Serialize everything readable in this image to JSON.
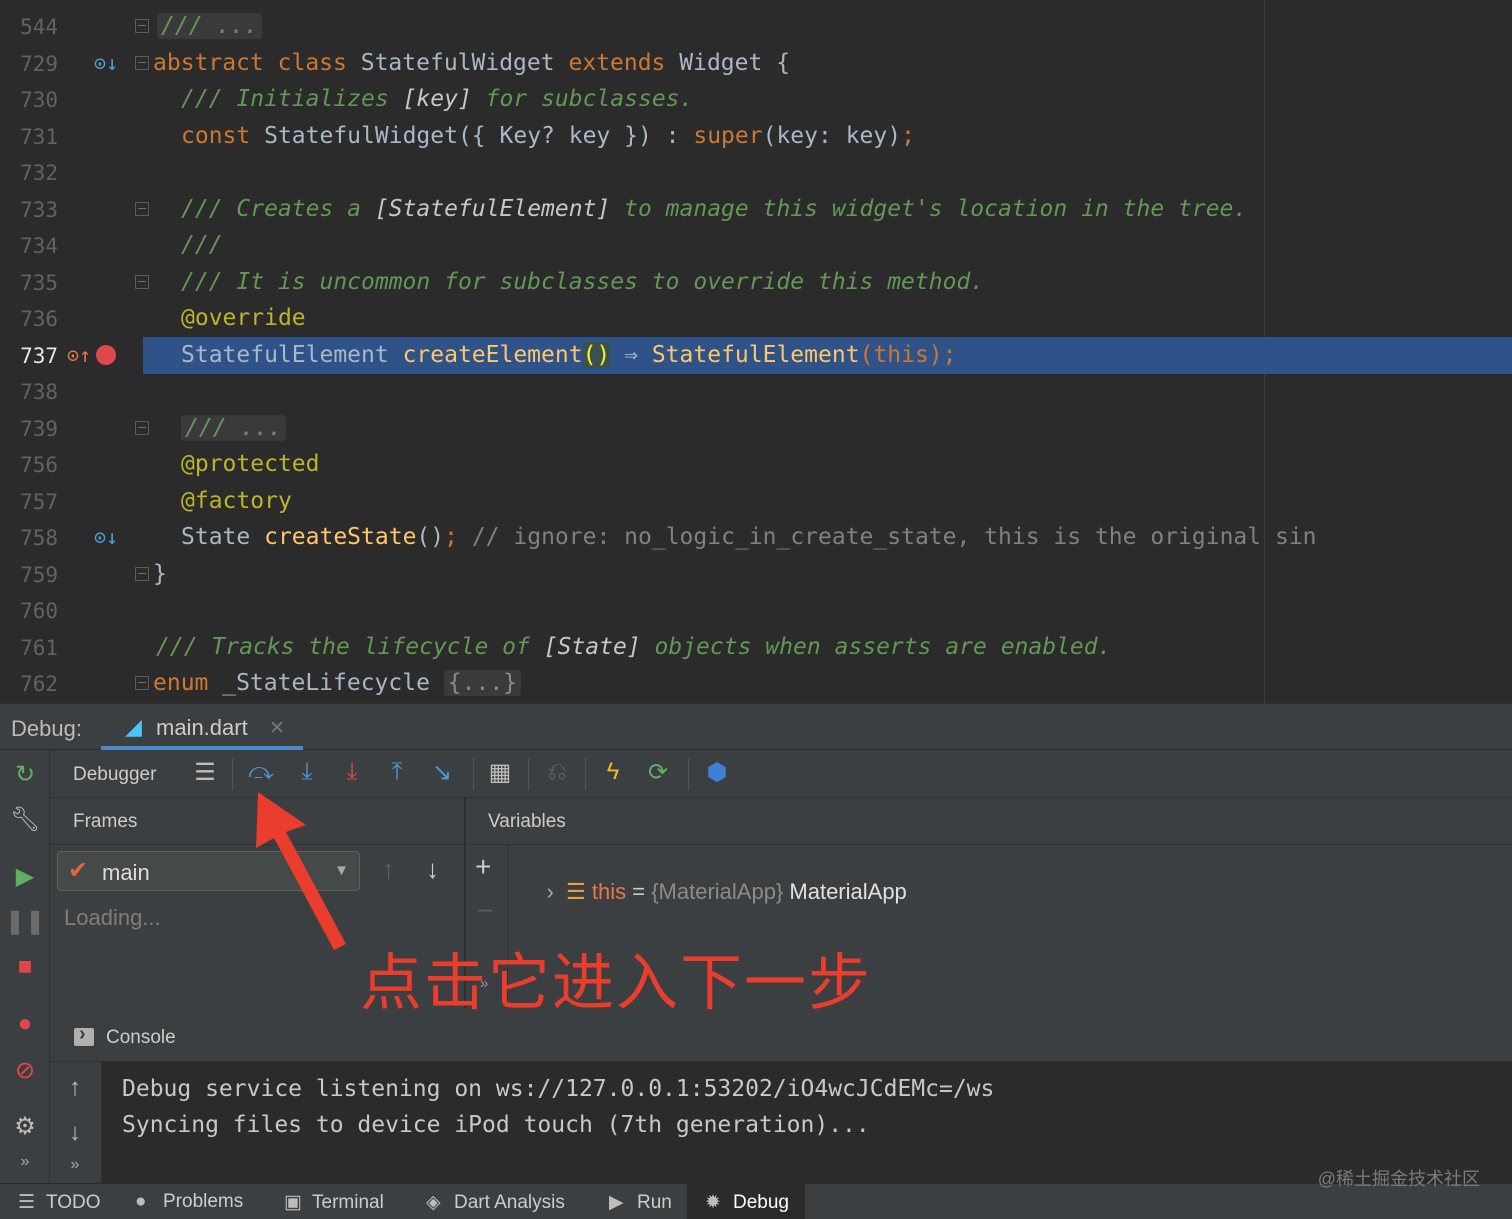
{
  "editor": {
    "lines": [
      {
        "num": "544",
        "text": "/// ..."
      },
      {
        "num": "729",
        "kw1": "abstract class",
        "name": "StatefulWidget",
        "kw2": "extends",
        "base": "Widget {"
      },
      {
        "num": "730",
        "comment_a": "/// Initializes ",
        "ref": "[key]",
        "comment_b": " for subclasses."
      },
      {
        "num": "731",
        "kw": "const",
        "body": " StatefulWidget({ Key? key }) : ",
        "sup": "super",
        "args": "(key: key)",
        "semi": ";"
      },
      {
        "num": "732"
      },
      {
        "num": "733",
        "comment_a": "/// Creates a ",
        "ref": "[StatefulElement]",
        "comment_b": " to manage this widget's location in the tree."
      },
      {
        "num": "734",
        "comment": "///"
      },
      {
        "num": "735",
        "comment": "/// It is uncommon for subclasses to override this method."
      },
      {
        "num": "736",
        "ann": "@",
        "text": "override"
      },
      {
        "num": "737",
        "type": "StatefulElement ",
        "fn": "createElement",
        "paren": "()",
        "arrow": " ⇒ ",
        "call": "StatefulElement",
        "open": "(",
        "thiskw": "this",
        "close": ")",
        "semi": ";"
      },
      {
        "num": "738"
      },
      {
        "num": "739",
        "text": "/// ..."
      },
      {
        "num": "756",
        "ann": "@",
        "text": "protected"
      },
      {
        "num": "757",
        "ann": "@",
        "text": "factory"
      },
      {
        "num": "758",
        "type": "State ",
        "fn": "createState",
        "paren": "()",
        "semi": ";",
        "comment": " // ignore: no_logic_in_create_state, this is the original sin"
      },
      {
        "num": "759",
        "text": "}"
      },
      {
        "num": "760"
      },
      {
        "num": "761",
        "comment_a": "/// Tracks the lifecycle of ",
        "ref": "[State]",
        "comment_b": " objects when asserts are enabled."
      },
      {
        "num": "762",
        "kw": "enum",
        "name": " _StateLifecycle ",
        "folded": "{...}"
      }
    ]
  },
  "debug": {
    "label": "Debug:",
    "tab_title": "main.dart",
    "toolbar_label": "Debugger",
    "frames_title": "Frames",
    "thread": "main",
    "loading": "Loading...",
    "variables_title": "Variables",
    "variable": {
      "name": "this",
      "op": " = ",
      "type": "{MaterialApp}",
      "value": " MaterialApp"
    },
    "console_label": "Console",
    "console_lines": [
      "Debug service listening on ws://127.0.0.1:53202/iO4wcJCdEMc=/ws",
      "Syncing files to device iPod touch (7th generation)..."
    ]
  },
  "statusbar": {
    "items": [
      "TODO",
      "Problems",
      "Terminal",
      "Dart Analysis",
      "Run",
      "Debug"
    ],
    "active": "Debug"
  },
  "annotation": "点击它进入下一步",
  "watermark": "@稀土掘金技术社区",
  "colors": {
    "accent": "#4a88c7",
    "current_line": "#2f5388",
    "breakpoint": "#e0474a",
    "annotation": "#ea3d2d"
  }
}
